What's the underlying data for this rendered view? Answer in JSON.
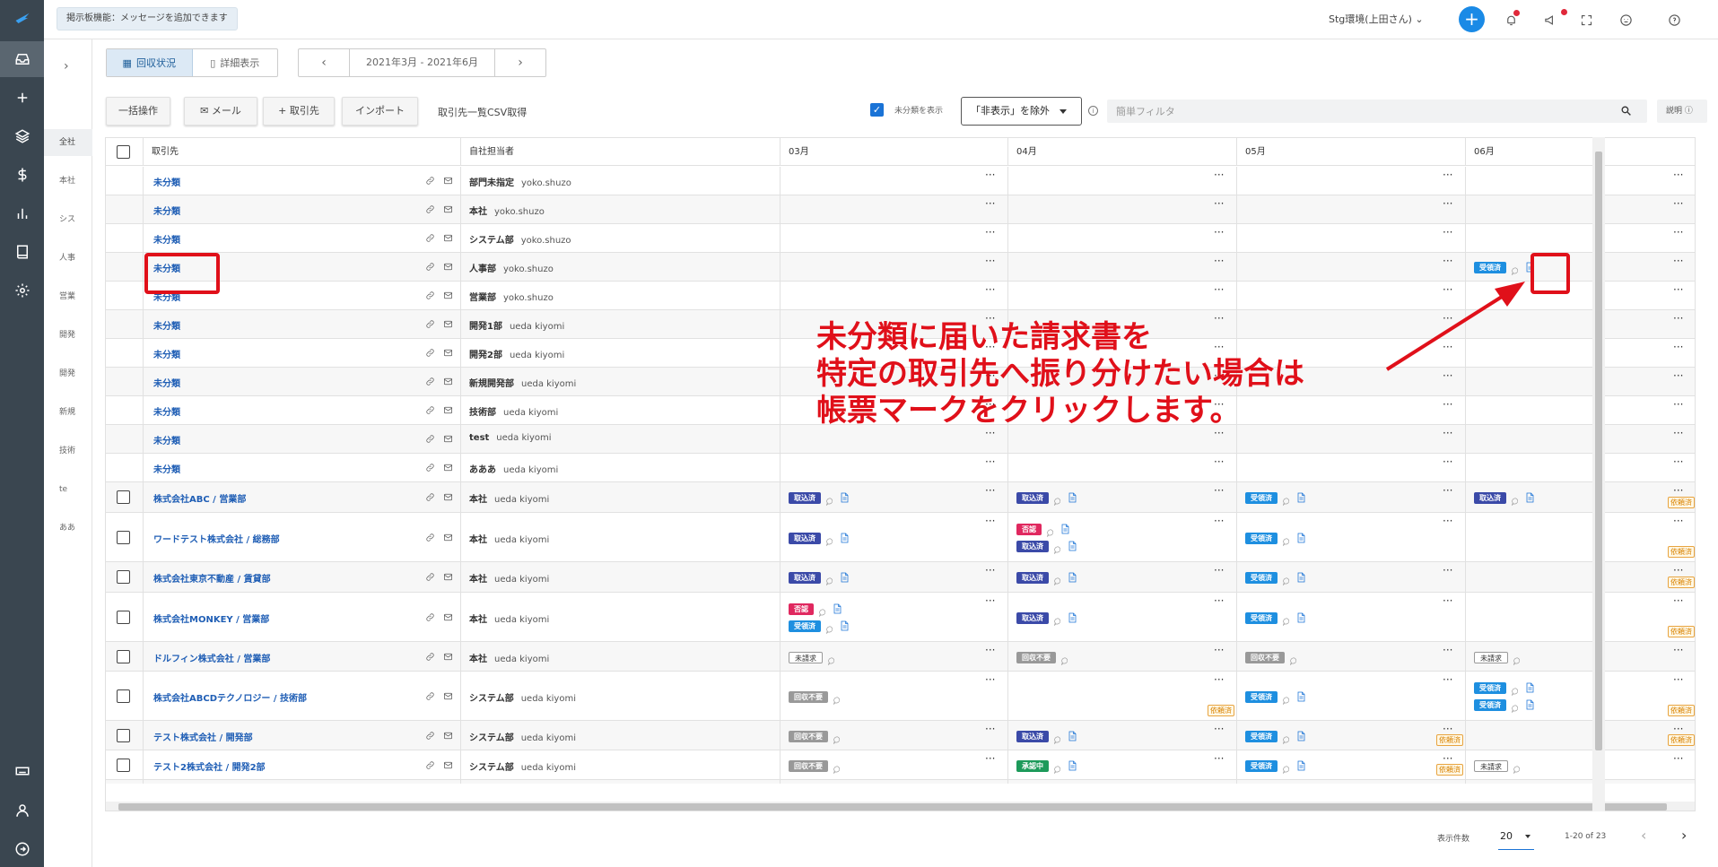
{
  "header": {
    "board_message": "掲示板機能：メッセージを追加できます",
    "env_label": "Stg環境(上田さん) ⌄"
  },
  "subnav": {
    "items": [
      "全社",
      "本社",
      "シス",
      "人事",
      "営業",
      "開発",
      "開発",
      "新規",
      "技術",
      "te",
      "ああ"
    ]
  },
  "view_toggle": {
    "collection": "回収状況",
    "detail": "詳細表示"
  },
  "period": {
    "label": "2021年3月 - 2021年6月"
  },
  "toolbar": {
    "bulk": "一括操作",
    "mail": "メール",
    "partner": "取引先",
    "import": "インポート",
    "csv": "取引先一覧CSV取得",
    "show_unclassified": "未分類を表示",
    "exclude": "「非表示」を除外",
    "filter_placeholder": "簡単フィルタ",
    "help": "説明"
  },
  "columns": {
    "partner": "取引先",
    "staff": "自社担当者",
    "months": [
      "03月",
      "04月",
      "05月",
      "06月"
    ]
  },
  "labels": {
    "tori": "取込済",
    "uke": "受領済",
    "hi": "否認",
    "mi": "未請求",
    "kai": "回収不要",
    "shonin": "承認中",
    "req": "依頼済"
  },
  "rows": [
    {
      "name": "未分類",
      "dept": "部門未指定",
      "user": "yoko.shuzo",
      "check": false,
      "h": 32,
      "cells": [
        [],
        [],
        [],
        []
      ],
      "req": [
        0,
        0,
        0,
        0
      ]
    },
    {
      "name": "未分類",
      "dept": "本社",
      "user": "yoko.shuzo",
      "check": false,
      "h": 32,
      "cells": [
        [],
        [],
        [],
        []
      ],
      "req": [
        0,
        0,
        0,
        0
      ]
    },
    {
      "name": "未分類",
      "dept": "システム部",
      "user": "yoko.shuzo",
      "check": false,
      "h": 32,
      "cells": [
        [],
        [],
        [],
        []
      ],
      "req": [
        0,
        0,
        0,
        0
      ]
    },
    {
      "name": "未分類",
      "dept": "人事部",
      "user": "yoko.shuzo",
      "check": false,
      "h": 32,
      "cells": [
        [],
        [],
        [],
        [
          [
            "uke",
            1,
            1
          ]
        ]
      ],
      "req": [
        0,
        0,
        0,
        0
      ]
    },
    {
      "name": "未分類",
      "dept": "営業部",
      "user": "yoko.shuzo",
      "check": false,
      "h": 32,
      "cells": [
        [],
        [],
        [],
        []
      ],
      "req": [
        0,
        0,
        0,
        0
      ]
    },
    {
      "name": "未分類",
      "dept": "開発1部",
      "user": "ueda kiyomi",
      "check": false,
      "h": 32,
      "cells": [
        [],
        [],
        [],
        []
      ],
      "req": [
        0,
        0,
        0,
        0
      ]
    },
    {
      "name": "未分類",
      "dept": "開発2部",
      "user": "ueda kiyomi",
      "check": false,
      "h": 32,
      "cells": [
        [],
        [],
        [],
        []
      ],
      "req": [
        0,
        0,
        0,
        0
      ]
    },
    {
      "name": "未分類",
      "dept": "新規開発部",
      "user": "ueda kiyomi",
      "check": false,
      "h": 32,
      "cells": [
        [],
        [],
        [],
        []
      ],
      "req": [
        0,
        0,
        0,
        0
      ]
    },
    {
      "name": "未分類",
      "dept": "技術部",
      "user": "ueda kiyomi",
      "check": false,
      "h": 32,
      "cells": [
        [],
        [],
        [],
        []
      ],
      "req": [
        0,
        0,
        0,
        0
      ]
    },
    {
      "name": "未分類",
      "dept": "test",
      "user": "ueda kiyomi",
      "check": false,
      "h": 32,
      "cells": [
        [],
        [],
        [],
        []
      ],
      "req": [
        0,
        0,
        0,
        0
      ]
    },
    {
      "name": "未分類",
      "dept": "あああ",
      "user": "ueda kiyomi",
      "check": false,
      "h": 32,
      "cells": [
        [],
        [],
        [],
        []
      ],
      "req": [
        0,
        0,
        0,
        0
      ]
    },
    {
      "name": "株式会社ABC / 営業部",
      "dept": "本社",
      "user": "ueda kiyomi",
      "check": true,
      "h": 34,
      "cells": [
        [
          [
            "tori",
            1,
            1
          ]
        ],
        [
          [
            "tori",
            1,
            1
          ]
        ],
        [
          [
            "uke",
            1,
            1
          ]
        ],
        [
          [
            "tori",
            1,
            1
          ]
        ]
      ],
      "req": [
        0,
        0,
        0,
        1
      ]
    },
    {
      "name": "ワードテスト株式会社 / 総務部",
      "dept": "本社",
      "user": "ueda kiyomi",
      "check": true,
      "h": 55,
      "cells": [
        [
          [
            "tori",
            1,
            1
          ]
        ],
        [
          [
            "hi",
            1,
            1
          ],
          [
            "tori",
            1,
            1
          ]
        ],
        [
          [
            "uke",
            1,
            1
          ]
        ],
        []
      ],
      "req": [
        0,
        0,
        0,
        1
      ]
    },
    {
      "name": "株式会社東京不動産 / 賃貸部",
      "dept": "本社",
      "user": "ueda kiyomi",
      "check": true,
      "h": 34,
      "cells": [
        [
          [
            "tori",
            1,
            1
          ]
        ],
        [
          [
            "tori",
            1,
            1
          ]
        ],
        [
          [
            "uke",
            1,
            1
          ]
        ],
        []
      ],
      "req": [
        0,
        0,
        0,
        1
      ]
    },
    {
      "name": "株式会社MONKEY / 営業部",
      "dept": "本社",
      "user": "ueda kiyomi",
      "check": true,
      "h": 55,
      "cells": [
        [
          [
            "hi",
            1,
            1
          ],
          [
            "uke",
            1,
            1
          ]
        ],
        [
          [
            "tori",
            1,
            1
          ]
        ],
        [
          [
            "uke",
            1,
            1
          ]
        ],
        []
      ],
      "req": [
        0,
        0,
        0,
        1
      ]
    },
    {
      "name": "ドルフィン株式会社 / 営業部",
      "dept": "本社",
      "user": "ueda kiyomi",
      "check": true,
      "h": 33,
      "cells": [
        [
          [
            "mi",
            1,
            0
          ]
        ],
        [
          [
            "kai",
            1,
            0
          ]
        ],
        [
          [
            "kai",
            1,
            0
          ]
        ],
        [
          [
            "mi",
            1,
            0
          ]
        ]
      ],
      "req": [
        0,
        0,
        0,
        0
      ]
    },
    {
      "name": "株式会社ABCDテクノロジー / 技術部",
      "dept": "システム部",
      "user": "ueda kiyomi",
      "check": true,
      "h": 55,
      "cells": [
        [
          [
            "kai",
            1,
            0
          ]
        ],
        [],
        [
          [
            "uke",
            1,
            1
          ]
        ],
        [
          [
            "uke",
            1,
            1
          ],
          [
            "uke",
            1,
            1
          ]
        ]
      ],
      "req": [
        0,
        1,
        0,
        1
      ]
    },
    {
      "name": "テスト株式会社 / 開発部",
      "dept": "システム部",
      "user": "ueda kiyomi",
      "check": true,
      "h": 33,
      "cells": [
        [
          [
            "kai",
            1,
            0
          ]
        ],
        [
          [
            "tori",
            1,
            1
          ]
        ],
        [
          [
            "uke",
            1,
            1
          ]
        ],
        []
      ],
      "req": [
        0,
        0,
        1,
        1
      ]
    },
    {
      "name": "テスト2株式会社 / 開発2部",
      "dept": "システム部",
      "user": "ueda kiyomi",
      "check": true,
      "h": 33,
      "cells": [
        [
          [
            "kai",
            1,
            0
          ]
        ],
        [
          [
            "shonin",
            1,
            1
          ]
        ],
        [
          [
            "uke",
            1,
            1
          ]
        ],
        [
          [
            "mi",
            1,
            0
          ]
        ]
      ],
      "req": [
        0,
        0,
        1,
        0
      ]
    },
    {
      "name": "",
      "dept": "",
      "user": "",
      "check": false,
      "h": 33,
      "cells": [
        [],
        [
          [
            "hi",
            1,
            1
          ]
        ],
        [],
        []
      ],
      "req": [
        0,
        0,
        0,
        0
      ]
    }
  ],
  "pager": {
    "per_page_label": "表示件数",
    "per_page": "20",
    "range": "1-20 of 23"
  },
  "annotation": {
    "line1": "未分類に届いた請求書を",
    "line2": "特定の取引先へ振り分けたい場合は",
    "line3": "帳票マークをクリックします。"
  },
  "colors": {
    "accent": "#1a73d6",
    "annotation": "#e0101a",
    "sidebar": "#3a4650"
  }
}
